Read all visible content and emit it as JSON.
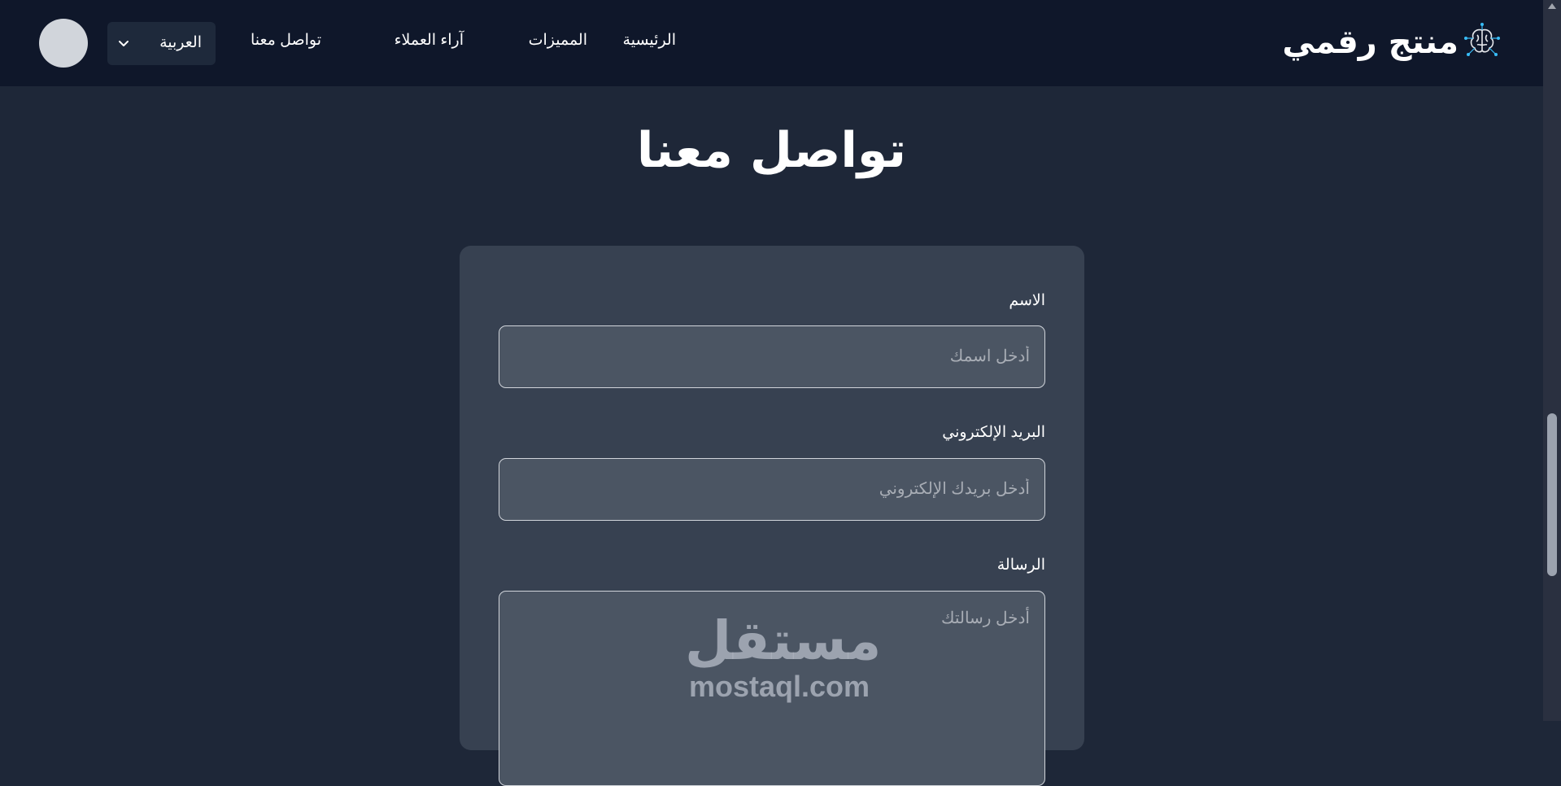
{
  "navbar": {
    "brand": "منتج رقمي",
    "links": [
      {
        "label": "الرئيسية"
      },
      {
        "label": "المميزات"
      },
      {
        "label": "آراء العملاء"
      },
      {
        "label": "تواصل معنا"
      }
    ],
    "language": {
      "selected": "العربية"
    }
  },
  "page": {
    "title": "تواصل معنا"
  },
  "form": {
    "name_label": "الاسم",
    "name_placeholder": "أدخل اسمك",
    "email_label": "البريد الإلكتروني",
    "email_placeholder": "أدخل بريدك الإلكتروني",
    "message_label": "الرسالة",
    "message_placeholder": "أدخل رسالتك"
  },
  "watermark": {
    "arabic": "مستقل",
    "latin": "mostaql.com"
  },
  "colors": {
    "page_bg": "#1e2738",
    "nav_bg": "#0f172a",
    "card_bg": "#374151",
    "input_bg": "#4b5563",
    "input_border": "#d1d5db",
    "logo_accent": "#38bdf8"
  },
  "icons": [
    "brain-circuit-icon",
    "chevron-down-icon"
  ]
}
